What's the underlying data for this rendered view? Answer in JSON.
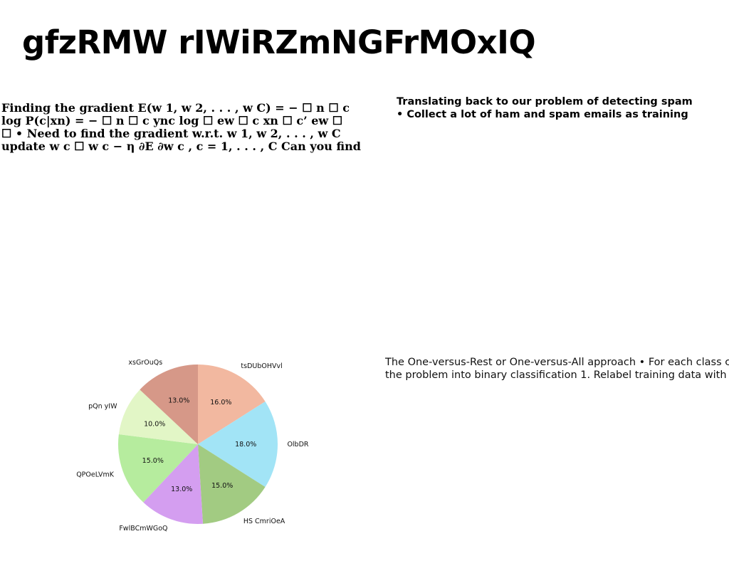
{
  "slide": {
    "title": "gfzRMW rIWiRZmNGFrMOxIQ",
    "left_text": [
      "Finding the gradient E(w 1, w 2, . . . , w C) = − ☐ n ☐ c",
      "log P(c|xn) = − ☐ n ☐ c ync log ☐ ew ☐ c xn ☐ c’ ew ☐",
      "☐ • Need to find the gradient w.r.t. w 1, w 2, . . . , w C",
      "update w c ☐ w c − η ∂E ∂w c , c = 1, . . . , C Can you find"
    ],
    "right_top": {
      "line1": "Translating back to our problem of detecting spam",
      "line2": "• Collect a lot of ham and spam emails as training"
    },
    "right_bottom": {
      "line1": "The One-versus-Rest or One-versus-All approach • For each class c,",
      "line2": "the problem into binary classification 1. Relabel training data with"
    }
  },
  "chart_data": {
    "type": "pie",
    "start_angle_deg": 90,
    "direction": "clockwise",
    "slices": [
      {
        "label": "tsDUbOHVvl",
        "value": 16.0,
        "pct": "16.0%",
        "color": "#f2b8a0"
      },
      {
        "label": "OlbDR",
        "value": 18.0,
        "pct": "18.0%",
        "color": "#a2e4f6"
      },
      {
        "label": "HS CmriOeA",
        "value": 15.0,
        "pct": "15.0%",
        "color": "#a2cb82"
      },
      {
        "label": "FwlBCmWGoQ",
        "value": 13.0,
        "pct": "13.0%",
        "color": "#d49ef0"
      },
      {
        "label": "QPOeLVmK",
        "value": 15.0,
        "pct": "15.0%",
        "color": "#b6ec9e"
      },
      {
        "label": "pQn yIW",
        "value": 10.0,
        "pct": "10.0%",
        "color": "#e2f6c6"
      },
      {
        "label": "xsGrOuQs",
        "value": 13.0,
        "pct": "13.0%",
        "color": "#d69888"
      }
    ]
  }
}
